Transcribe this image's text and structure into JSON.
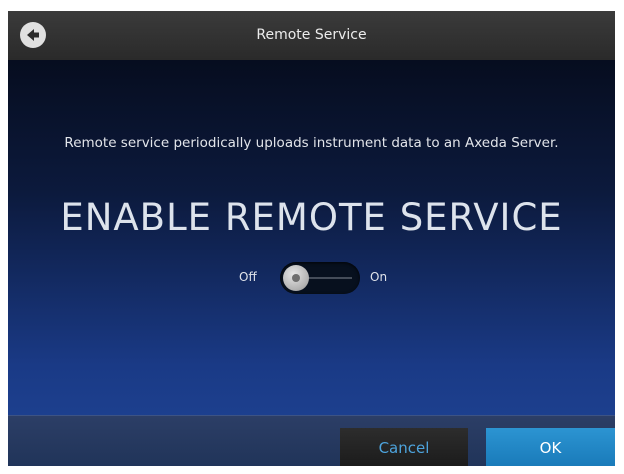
{
  "header": {
    "title": "Remote Service",
    "back_icon": "arrow-left-circle-icon"
  },
  "main": {
    "description": "Remote service periodically uploads instrument data to an Axeda Server.",
    "heading": "ENABLE REMOTE SERVICE",
    "toggle": {
      "off_label": "Off",
      "on_label": "On",
      "state": "off"
    }
  },
  "footer": {
    "cancel_label": "Cancel",
    "ok_label": "OK"
  },
  "colors": {
    "accent": "#2a8fcf",
    "cancel_text": "#4da3dc"
  }
}
